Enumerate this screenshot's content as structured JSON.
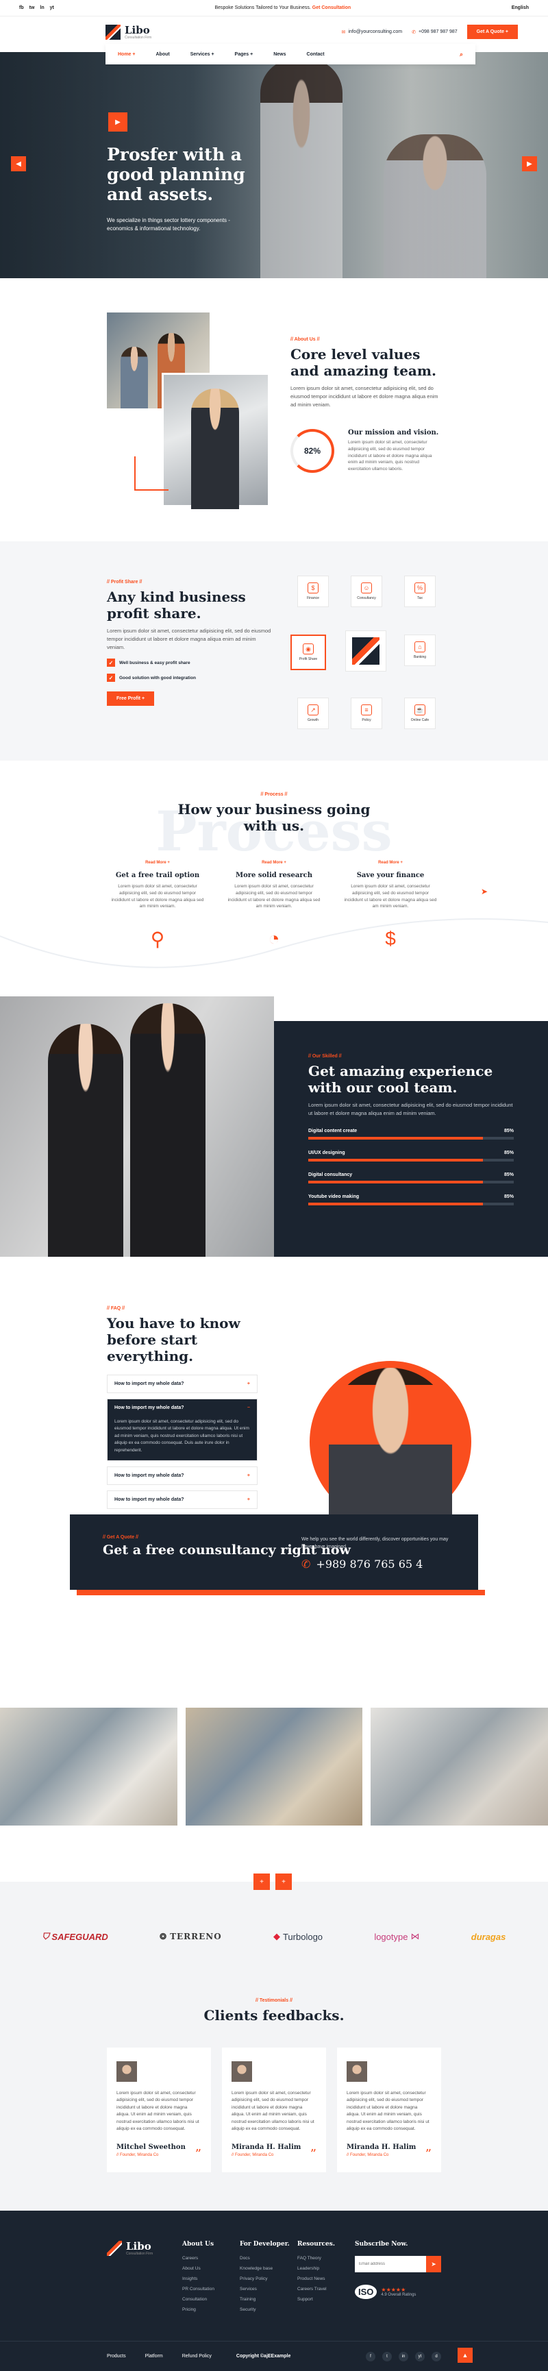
{
  "topbar": {
    "social": [
      "fb",
      "tw",
      "ln",
      "yt"
    ],
    "promo_text": "Bespoke Solutions Tailored to Your Business.",
    "promo_link": "Get Consultation",
    "lang": "English"
  },
  "header": {
    "logo": "Libo",
    "logo_sub": "Consultation Firm",
    "email": "info@yourconsulting.com",
    "phone": "+098 987 987 987",
    "quote_button": "Get A Quote +"
  },
  "nav": {
    "items": [
      "Home +",
      "About",
      "Services +",
      "Pages +",
      "News",
      "Contact"
    ]
  },
  "hero": {
    "title": "Prosfer with a good planning and assets.",
    "text": "We specialize in things sector lottery components - economics & informational technology."
  },
  "about": {
    "tag": "// About Us //",
    "title": "Core level values and amazing team.",
    "text": "Lorem ipsum dolor sit amet, consectetur adipisicing elit, sed do eiusmod tempor incididunt ut labore et dolore magna aliqua enim ad minim veniam.",
    "ring_value": "82%",
    "mission_title": "Our mission and vision.",
    "mission_text": "Lorem ipsum dolor sit amet, consectetur adipisicing elit, sed do eiusmod tempor incididunt ut labore et dolore magna aliqua enim ad minim veniam, quis nostrud exercitation ullamco laboris."
  },
  "profit": {
    "tag": "// Profit Share //",
    "title": "Any kind business profit share.",
    "text": "Lorem ipsum dolor sit amet, consectetur adipisicing elit, sed do eiusmod tempor incididunt ut labore et dolore magna aliqua enim ad minim veniam.",
    "checks": [
      "Well business & easy profit share",
      "Good solution with good integration"
    ],
    "button": "Free Profit +",
    "icons": [
      "Finance",
      "Consultancy",
      "Tax",
      "Profit Share",
      "Banking",
      "Growth",
      "Policy",
      "Online Cafe"
    ]
  },
  "process": {
    "watermark": "Process",
    "tag": "// Process //",
    "title": "How your business going with us.",
    "steps": [
      {
        "more": "Read More +",
        "title": "Get a free trail option",
        "text": "Lorem ipsum dolor sit amet, consectetur adipisicing elit, sed do eiusmod tempor incididunt ut labore et dolore magna aliqua sed am minim veniam."
      },
      {
        "more": "Read More +",
        "title": "More solid research",
        "text": "Lorem ipsum dolor sit amet, consectetur adipisicing elit, sed do eiusmod tempor incididunt ut labore et dolore magna aliqua sed am minim veniam."
      },
      {
        "more": "Read More +",
        "title": "Save your finance",
        "text": "Lorem ipsum dolor sit amet, consectetur adipisicing elit, sed do eiusmod tempor incididunt ut labore et dolore magna aliqua sed am minim veniam."
      }
    ]
  },
  "team": {
    "tag": "// Our Skilled //",
    "title": "Get amazing experience with our cool team.",
    "text": "Lorem ipsum dolor sit amet, consectetur adipisicing elit, sed do eiusmod tempor incididunt ut labore et dolore magna aliqua enim ad minim veniam.",
    "skills": [
      {
        "label": "Digital content create",
        "value": "85%",
        "fraction": 0.85
      },
      {
        "label": "UI/UX designing",
        "value": "85%",
        "fraction": 0.85
      },
      {
        "label": "Digital consultancy",
        "value": "85%",
        "fraction": 0.85
      },
      {
        "label": "Youtube video making",
        "value": "85%",
        "fraction": 0.85
      }
    ]
  },
  "faq": {
    "tag": "// FAQ //",
    "title": "You have to know before start everything.",
    "questions": [
      "How to import my whole data?",
      "How to import my whole data?",
      "How to import my whole data?",
      "How to import my whole data?"
    ],
    "answer": "Lorem ipsum dolor sit amet, consectetur adipisicing elit, sed do eiusmod tempor incididunt ut labore et dolore magna aliqua. Ut enim ad minim veniam, quis nostrud exercitation ullamco laboris nisi ut aliquip ex ea commodo consequat. Duis aute irure dolor in reprehenderit."
  },
  "cta": {
    "tag": "// Get A Quote //",
    "title": "Get a free counsultancy right now",
    "text": "We help you see the world differently, discover opportunities you may never have imagined.",
    "phone": "+989 876 765 65 4"
  },
  "gallery": {
    "prev": "+",
    "next": "+"
  },
  "brands": [
    "SAFEGUARD",
    "TERRENO",
    "Turbologo",
    "logotype",
    "duragas"
  ],
  "testimonials": {
    "tag": "// Testimonials //",
    "title": "Clients feedbacks.",
    "items": [
      {
        "text": "Lorem ipsum dolor sit amet, consectetur adipisicing elit, sed do eiusmod tempor incididunt ut labore et dolore magna aliqua. Ut enim ad minim veniam, quis nostrud exercitation ullamco laboris nisi ut aliquip ex ea commodo consequat.",
        "name": "Mitchel Sweethon",
        "role": "// Founder, Miranda Co"
      },
      {
        "text": "Lorem ipsum dolor sit amet, consectetur adipisicing elit, sed do eiusmod tempor incididunt ut labore et dolore magna aliqua. Ut enim ad minim veniam, quis nostrud exercitation ullamco laboris nisi ut aliquip ex ea commodo consequat.",
        "name": "Miranda H. Halim",
        "role": "// Founder, Miranda Co"
      },
      {
        "text": "Lorem ipsum dolor sit amet, consectetur adipisicing elit, sed do eiusmod tempor incididunt ut labore et dolore magna aliqua. Ut enim ad minim veniam, quis nostrud exercitation ullamco laboris nisi ut aliquip ex ea commodo consequat.",
        "name": "Miranda H. Halim",
        "role": "// Founder, Miranda Co"
      }
    ]
  },
  "footer": {
    "logo": "Libo",
    "logo_sub": "Consultation Firm",
    "about_title": "About Us",
    "about_links": [
      "Careers",
      "About Us",
      "Insights",
      "PR Consultation",
      "Consultation",
      "Pricing"
    ],
    "dev_title": "For Developer.",
    "dev_links": [
      "Docs",
      "Knowledge base",
      "Privacy Policy",
      "Services",
      "Training",
      "Security"
    ],
    "res_title": "Resources.",
    "res_links": [
      "FAQ Theory",
      "Leadership",
      "Product News",
      "Careers Travel",
      "Support"
    ],
    "sub_title": "Subscribe Now.",
    "sub_placeholder": "Email address",
    "iso": "ISO",
    "stars": "★★★★★",
    "rating": "4.9 Overall Ratings",
    "bottom_links": [
      "Products",
      "Platform",
      "Refund Policy"
    ],
    "copyright": "Copyright ©ajEExample",
    "socials": [
      "f",
      "t",
      "in",
      "yt",
      "d"
    ]
  }
}
